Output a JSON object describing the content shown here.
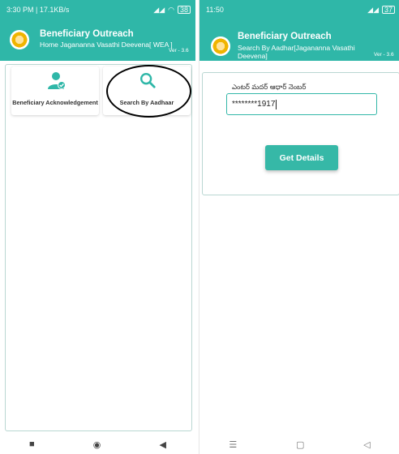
{
  "left": {
    "status": {
      "time": "3:30 PM | 17.1KB/s",
      "icons": [
        "signal-icon",
        "wifi-icon",
        "battery-icon"
      ],
      "battery": "38"
    },
    "header": {
      "title": "Beneficiary Outreach",
      "subtitle": "Home Jagananna Vasathi Deevena[ WEA ]",
      "version": "Ver - 3.6"
    },
    "tiles": [
      {
        "label": "Beneficiary Acknowledgement",
        "icon": "user-check-icon"
      },
      {
        "label": "Search By Aadhaar",
        "icon": "search-icon"
      }
    ]
  },
  "right": {
    "status": {
      "time": "11:50",
      "battery": "37"
    },
    "header": {
      "title": "Beneficiary Outreach",
      "subtitle_line1": "Search By Aadhar[Jagananna Vasathi",
      "subtitle_line2": "Deevena]",
      "version": "Ver - 3.6"
    },
    "form": {
      "label": "ఎంటర్ మదర్ ఆధార్ నెంబర్",
      "value": "********1917",
      "button": "Get Details"
    }
  },
  "colors": {
    "primary": "#2fb7a8",
    "button": "#36b8a7",
    "annotation": "#000000"
  }
}
